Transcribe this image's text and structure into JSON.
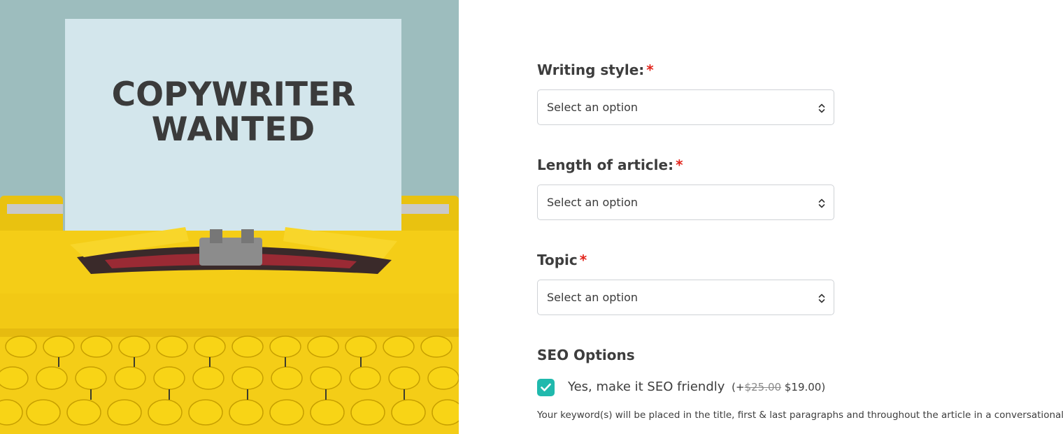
{
  "hero": {
    "headline_line1": "COPYWRITER",
    "headline_line2": "WANTED",
    "colors": {
      "background": "#9dbdbe",
      "paper": "#d3e6ec",
      "typewriter": "#f6d11c",
      "keys": "#f8d416"
    }
  },
  "form": {
    "fields": [
      {
        "label": "Writing style:",
        "required_mark": "*",
        "placeholder": "Select an option"
      },
      {
        "label": "Length of article:",
        "required_mark": "*",
        "placeholder": "Select an option"
      },
      {
        "label": "Topic",
        "required_mark": "*",
        "placeholder": "Select an option"
      }
    ],
    "seo": {
      "title": "SEO Options",
      "checkbox_checked": true,
      "checkbox_label": "Yes, make it SEO friendly",
      "price_prefix": "(+",
      "price_old": "$25.00",
      "price_new": "$19.00)",
      "help_text": "Your keyword(s) will be placed in the title, first & last paragraphs and throughout the article in a conversational way"
    },
    "colors": {
      "required": "#e2241b",
      "checkbox": "#20b9ad",
      "border": "#cfd2d6"
    }
  }
}
